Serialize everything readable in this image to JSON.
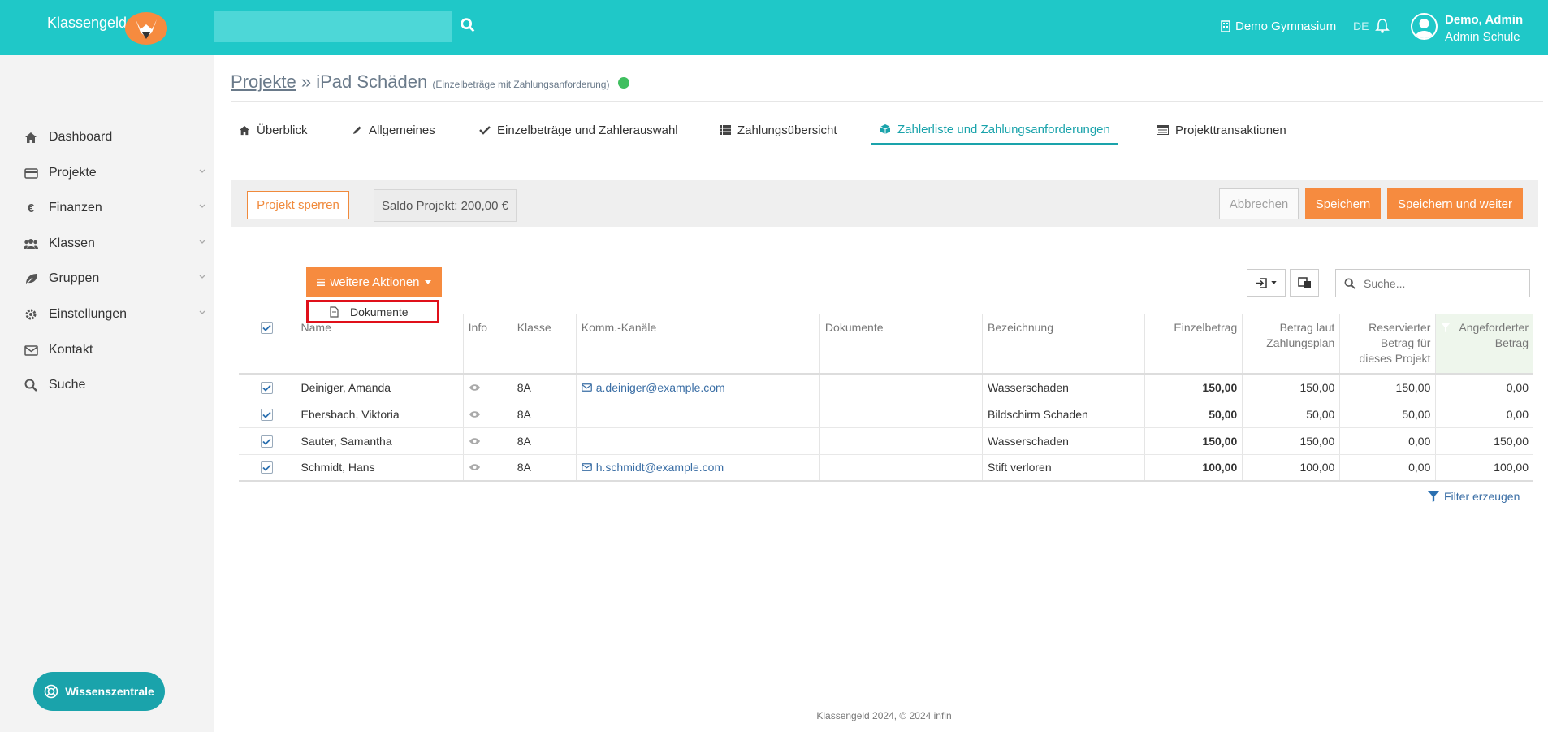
{
  "header": {
    "brand": "Klassengeld",
    "search_placeholder": "",
    "school": "Demo Gymnasium",
    "language": "DE",
    "user_name": "Demo, Admin",
    "user_school": "Admin Schule",
    "accent_color": "#1fc8c8"
  },
  "sidebar": {
    "items": [
      {
        "label": "Dashboard",
        "icon": "home-icon",
        "has_chevron": false
      },
      {
        "label": "Projekte",
        "icon": "credit-card-icon",
        "has_chevron": true
      },
      {
        "label": "Finanzen",
        "icon": "euro-icon",
        "has_chevron": true
      },
      {
        "label": "Klassen",
        "icon": "users-icon",
        "has_chevron": true
      },
      {
        "label": "Gruppen",
        "icon": "leaf-icon",
        "has_chevron": true
      },
      {
        "label": "Einstellungen",
        "icon": "gear-icon",
        "has_chevron": true
      },
      {
        "label": "Kontakt",
        "icon": "envelope-icon",
        "has_chevron": false
      },
      {
        "label": "Suche",
        "icon": "search-icon",
        "has_chevron": false
      }
    ],
    "help_button": "Wissenszentrale"
  },
  "breadcrumb": {
    "parent": "Projekte",
    "separator": "»",
    "project": "iPad Schäden",
    "subtitle": "(Einzelbeträge mit Zahlungsanforderung)",
    "status_color": "#3fbf5f"
  },
  "tabs": [
    {
      "label": "Überblick",
      "icon": "home-icon",
      "active": false
    },
    {
      "label": "Allgemeines",
      "icon": "pencil-icon",
      "active": false
    },
    {
      "label": "Einzelbeträge und Zahlerauswahl",
      "icon": "check-icon",
      "active": false
    },
    {
      "label": "Zahlungsübersicht",
      "icon": "list-icon",
      "active": false
    },
    {
      "label": "Zahlerliste und Zahlungsanforderungen",
      "icon": "cube-icon",
      "active": true
    },
    {
      "label": "Projekttransaktionen",
      "icon": "table-icon",
      "active": false
    }
  ],
  "toolbar": {
    "lock_label": "Projekt sperren",
    "saldo_label": "Saldo Projekt: 200,00 €",
    "cancel_label": "Abbrechen",
    "save_label": "Speichern",
    "save_next_label": "Speichern und weiter"
  },
  "actions": {
    "menu_label": "weitere Aktionen",
    "dropdown_item": "Dokumente"
  },
  "table_search": {
    "placeholder": "Suche..."
  },
  "table": {
    "headers": [
      "Name",
      "Info",
      "Klasse",
      "Komm.-Kanäle",
      "Dokumente",
      "Bezeichnung",
      "Einzelbetrag",
      "Betrag laut Zahlungsplan",
      "Reservierter Betrag für dieses Projekt",
      "Angeforderter Betrag"
    ],
    "rows": [
      {
        "name": "Deiniger, Amanda",
        "klasse": "8A",
        "email": "a.deiniger@example.com",
        "dokumente": "",
        "bezeichnung": "Wasserschaden",
        "einzelbetrag": "150,00",
        "zahlungsplan": "150,00",
        "reserviert": "150,00",
        "angefordert": "0,00",
        "angefordert_red": false
      },
      {
        "name": "Ebersbach, Viktoria",
        "klasse": "8A",
        "email": "",
        "dokumente": "",
        "bezeichnung": "Bildschirm Schaden",
        "einzelbetrag": "50,00",
        "zahlungsplan": "50,00",
        "reserviert": "50,00",
        "angefordert": "0,00",
        "angefordert_red": false
      },
      {
        "name": "Sauter, Samantha",
        "klasse": "8A",
        "email": "",
        "dokumente": "",
        "bezeichnung": "Wasserschaden",
        "einzelbetrag": "150,00",
        "zahlungsplan": "150,00",
        "reserviert": "0,00",
        "angefordert": "150,00",
        "angefordert_red": true
      },
      {
        "name": "Schmidt, Hans",
        "klasse": "8A",
        "email": "h.schmidt@example.com",
        "dokumente": "",
        "bezeichnung": "Stift verloren",
        "einzelbetrag": "100,00",
        "zahlungsplan": "100,00",
        "reserviert": "0,00",
        "angefordert": "100,00",
        "angefordert_red": true
      }
    ]
  },
  "filter_label": "Filter erzeugen",
  "footer": "Klassengeld 2024, © 2024 infin"
}
